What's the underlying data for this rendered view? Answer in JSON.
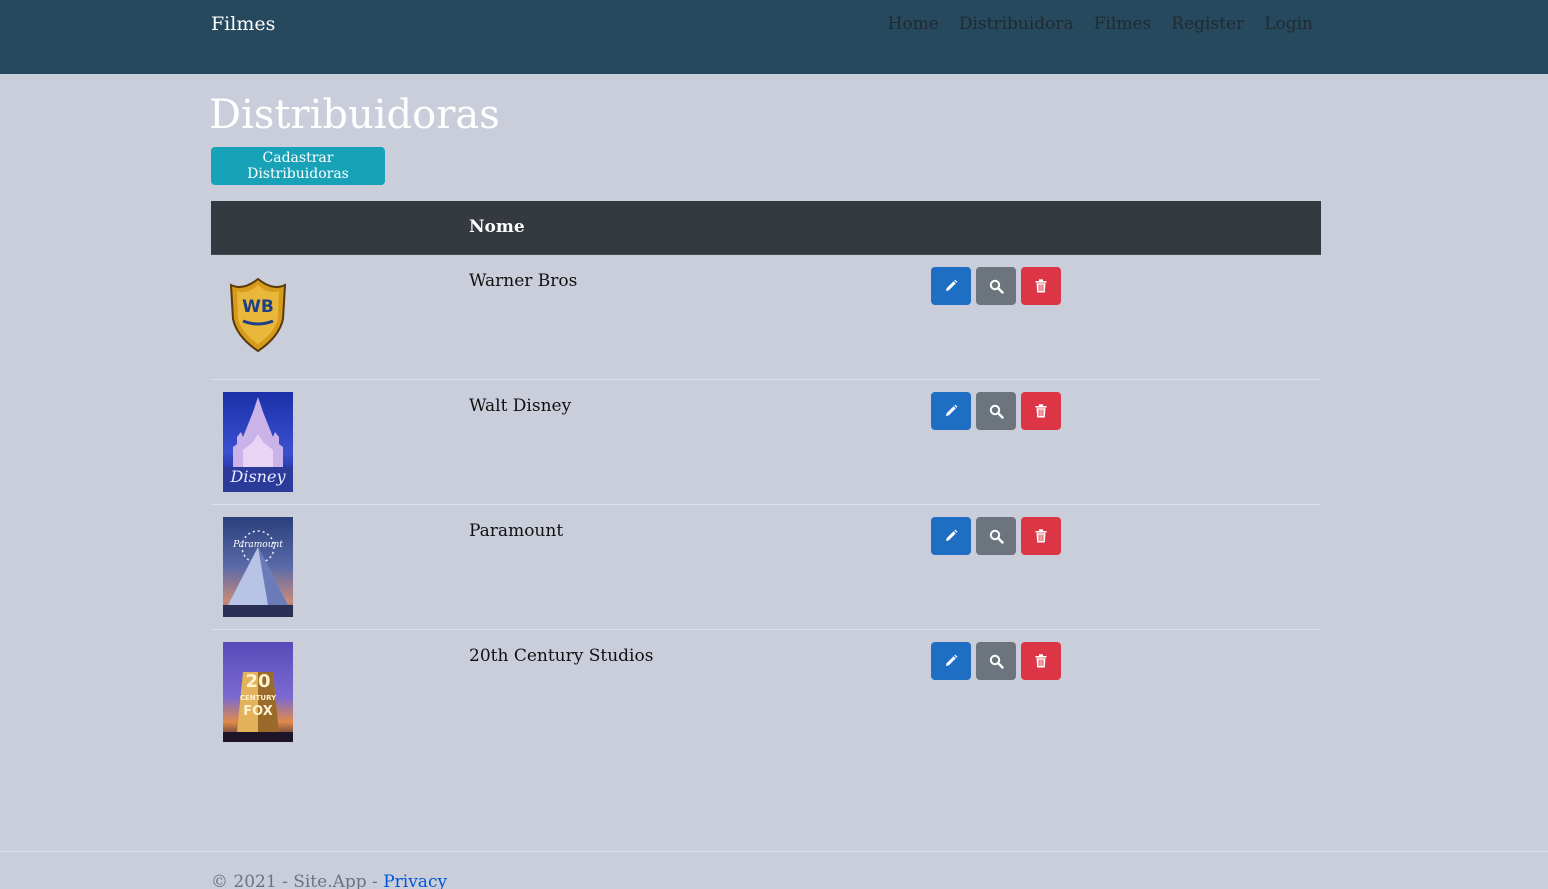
{
  "navbar": {
    "brand": "Filmes",
    "links": [
      {
        "label": "Home"
      },
      {
        "label": "Distribuidora"
      },
      {
        "label": "Filmes"
      },
      {
        "label": "Register"
      },
      {
        "label": "Login"
      }
    ]
  },
  "page": {
    "title": "Distribuidoras",
    "create_button": "Cadastrar Distribuidoras"
  },
  "table": {
    "headers": [
      "",
      "Nome",
      ""
    ],
    "rows": [
      {
        "name": "Warner Bros",
        "logo": "warner-bros-logo-image"
      },
      {
        "name": "Walt Disney",
        "logo": "disney-castle-logo-image"
      },
      {
        "name": "Paramount",
        "logo": "paramount-mountain-logo-image"
      },
      {
        "name": "20th Century Studios",
        "logo": "20th-century-fox-logo-image"
      }
    ],
    "row_actions": [
      "pencil-icon",
      "magnifier-icon",
      "trash-icon"
    ]
  },
  "footer": {
    "text": "© 2021 - Site.App - ",
    "privacy_link": "Privacy"
  },
  "colors": {
    "navbar": "#27495d",
    "background": "#c9ceda",
    "create_button": "#17a2b8",
    "table_header": "#343a40",
    "edit": "#1e6ec3",
    "details": "#6c757d",
    "delete": "#dc3545",
    "link": "#0056d6"
  }
}
